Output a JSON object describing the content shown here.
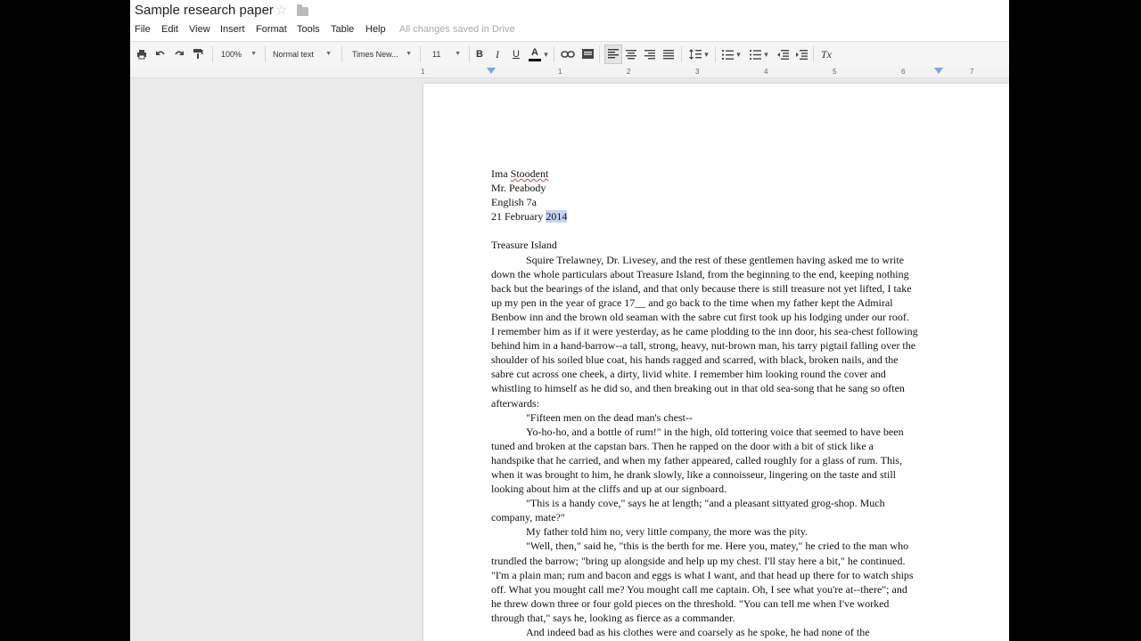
{
  "app": {
    "doc_title": "Sample research paper",
    "saved_status": "All changes saved in Drive"
  },
  "menu": [
    "File",
    "Edit",
    "View",
    "Insert",
    "Format",
    "Tools",
    "Table",
    "Help"
  ],
  "toolbar": {
    "zoom": "100%",
    "style": "Normal text",
    "font": "Times New...",
    "size": "11",
    "bold": "B",
    "italic": "I",
    "underline": "U",
    "text_color": "A",
    "clear_formatting": "Tx"
  },
  "ruler": {
    "numbers": [
      "1",
      "1",
      "2",
      "3",
      "4",
      "5",
      "6",
      "7"
    ]
  },
  "document": {
    "heading": {
      "name_first": "Ima ",
      "name_last": "Stoodent",
      "teacher": "Mr. Peabody",
      "course": "English 7a",
      "date_prefix": "21 February ",
      "date_year": "2014"
    },
    "title": "Treasure Island",
    "lines": [
      "Squire Trelawney, Dr. Livesey, and the rest of these gentlemen having asked me to write",
      "down the whole particulars about Treasure Island, from the beginning to the end, keeping nothing",
      "back but the bearings of the island, and that only because there is still treasure not yet lifted, I take",
      "up my pen in the year of grace 17__ and go back to the time when my father kept the Admiral",
      "Benbow inn and the brown old seaman with the sabre cut first took up his lodging under our roof.",
      "I remember him as if it were yesterday, as he came plodding to the inn door, his sea-chest following",
      "behind him in a hand-barrow--a tall, strong, heavy, nut-brown man, his tarry pigtail falling over the",
      "shoulder of his soiled blue coat, his hands ragged and scarred, with black, broken nails, and the",
      "sabre cut across one cheek, a dirty, livid white. I remember him looking round the cover and",
      "whistling to himself as he did so, and then breaking out in that old sea-song that he sang so often",
      "afterwards:",
      "\"Fifteen men on the dead man's chest--",
      "Yo-ho-ho, and a bottle of rum!\" in the high, old tottering voice that seemed to have been",
      "tuned and broken at the capstan bars. Then he rapped on the door with a bit of stick like a",
      "handspike that he carried, and when my father appeared, called roughly for a glass of rum. This,",
      "when it was brought to him, he drank slowly, like a connoisseur, lingering on the taste and still",
      "looking about him at the cliffs and up at our signboard.",
      "\"This is a handy cove,\" says he at length; \"and a pleasant sittyated grog-shop. Much",
      "company, mate?\"",
      "My father told him no, very little company, the more was the pity.",
      "\"Well, then,\" said he, \"this is the berth for me. Here you, matey,\" he cried to the man who",
      "trundled the barrow; \"bring up alongside and help up my chest. I'll stay here a bit,\" he continued.",
      "\"I'm a plain man; rum and bacon and eggs is what I want, and that head up there for to watch ships",
      "off. What you mought call me? You mought call me captain. Oh, I see what you're at--there\"; and",
      "he threw down three or four gold pieces on the threshold. \"You can tell me when I've worked",
      "through that,\" says he, looking as fierce as a commander.",
      "And indeed bad as his clothes were and coarsely as he spoke, he had none of the"
    ]
  }
}
